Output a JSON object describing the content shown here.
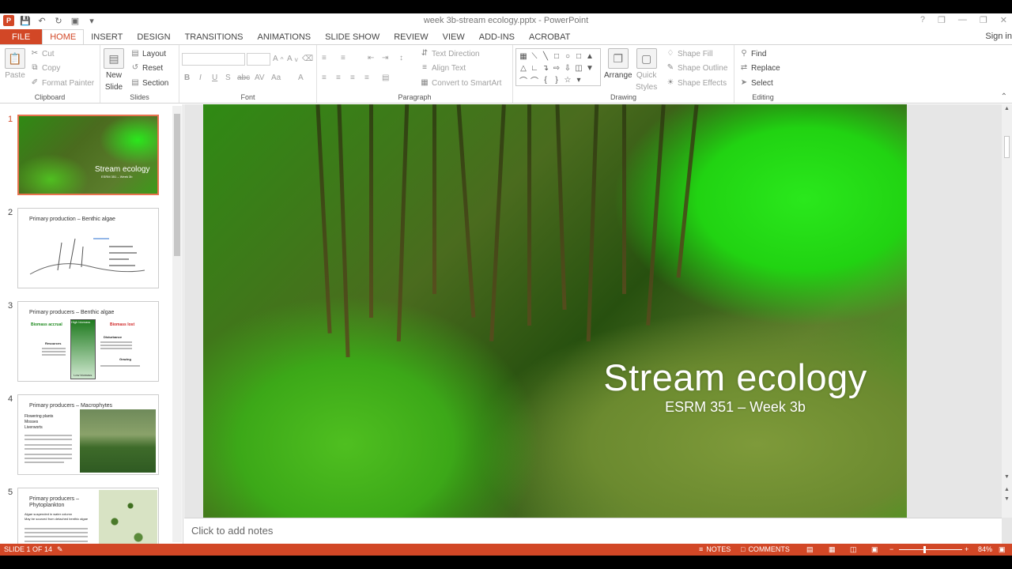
{
  "window": {
    "title": "week 3b-stream ecology.pptx - PowerPoint",
    "controls": [
      "?",
      "❐",
      "—",
      "❐",
      "✕"
    ]
  },
  "tabs": [
    "FILE",
    "HOME",
    "INSERT",
    "DESIGN",
    "TRANSITIONS",
    "ANIMATIONS",
    "SLIDE SHOW",
    "REVIEW",
    "VIEW",
    "ADD-INS",
    "ACROBAT"
  ],
  "active_tab": "HOME",
  "signin": "Sign in",
  "ribbon": {
    "clipboard": {
      "label": "Clipboard",
      "paste": "Paste",
      "cut": "Cut",
      "copy": "Copy",
      "format_painter": "Format Painter"
    },
    "slides": {
      "label": "Slides",
      "new_slide_1": "New",
      "new_slide_2": "Slide",
      "layout": "Layout",
      "reset": "Reset",
      "section": "Section"
    },
    "font": {
      "label": "Font"
    },
    "paragraph": {
      "label": "Paragraph",
      "text_direction": "Text Direction",
      "align_text": "Align Text",
      "convert_smartart": "Convert to SmartArt"
    },
    "drawing": {
      "label": "Drawing",
      "arrange": "Arrange",
      "quick_styles_1": "Quick",
      "quick_styles_2": "Styles",
      "shape_fill": "Shape Fill",
      "shape_outline": "Shape Outline",
      "shape_effects": "Shape Effects"
    },
    "editing": {
      "label": "Editing",
      "find": "Find",
      "replace": "Replace",
      "select": "Select"
    }
  },
  "thumbnails": [
    {
      "num": "1",
      "caption": "Stream ecology",
      "subcaption": "ESRM 351 – Week 3b"
    },
    {
      "num": "2",
      "title": "Primary production – Benthic algae"
    },
    {
      "num": "3",
      "title": "Primary producers – Benthic algae",
      "left_head": "Biomass accrual",
      "right_head": "Biomass lost",
      "mid_head": "High biomass",
      "resources": "Resources",
      "disturbance": "Disturbance",
      "grazing": "Grazing",
      "low": "Low biomass"
    },
    {
      "num": "4",
      "title": "Primary producers – Macrophytes",
      "bullets": [
        "Flowering plants",
        "Mosses",
        "Liverworts"
      ]
    },
    {
      "num": "5",
      "title": "Primary producers –",
      "title2": "Phytoplankton",
      "bullets": [
        "Algae suspended in water column",
        "May be sourced from detached benthic algae"
      ]
    }
  ],
  "slide": {
    "title": "Stream ecology",
    "subtitle": "ESRM 351 – Week 3b"
  },
  "notes_placeholder": "Click to add notes",
  "status": {
    "slide_info": "SLIDE 1 OF 14",
    "notes": "NOTES",
    "comments": "COMMENTS",
    "zoom": "84%"
  }
}
